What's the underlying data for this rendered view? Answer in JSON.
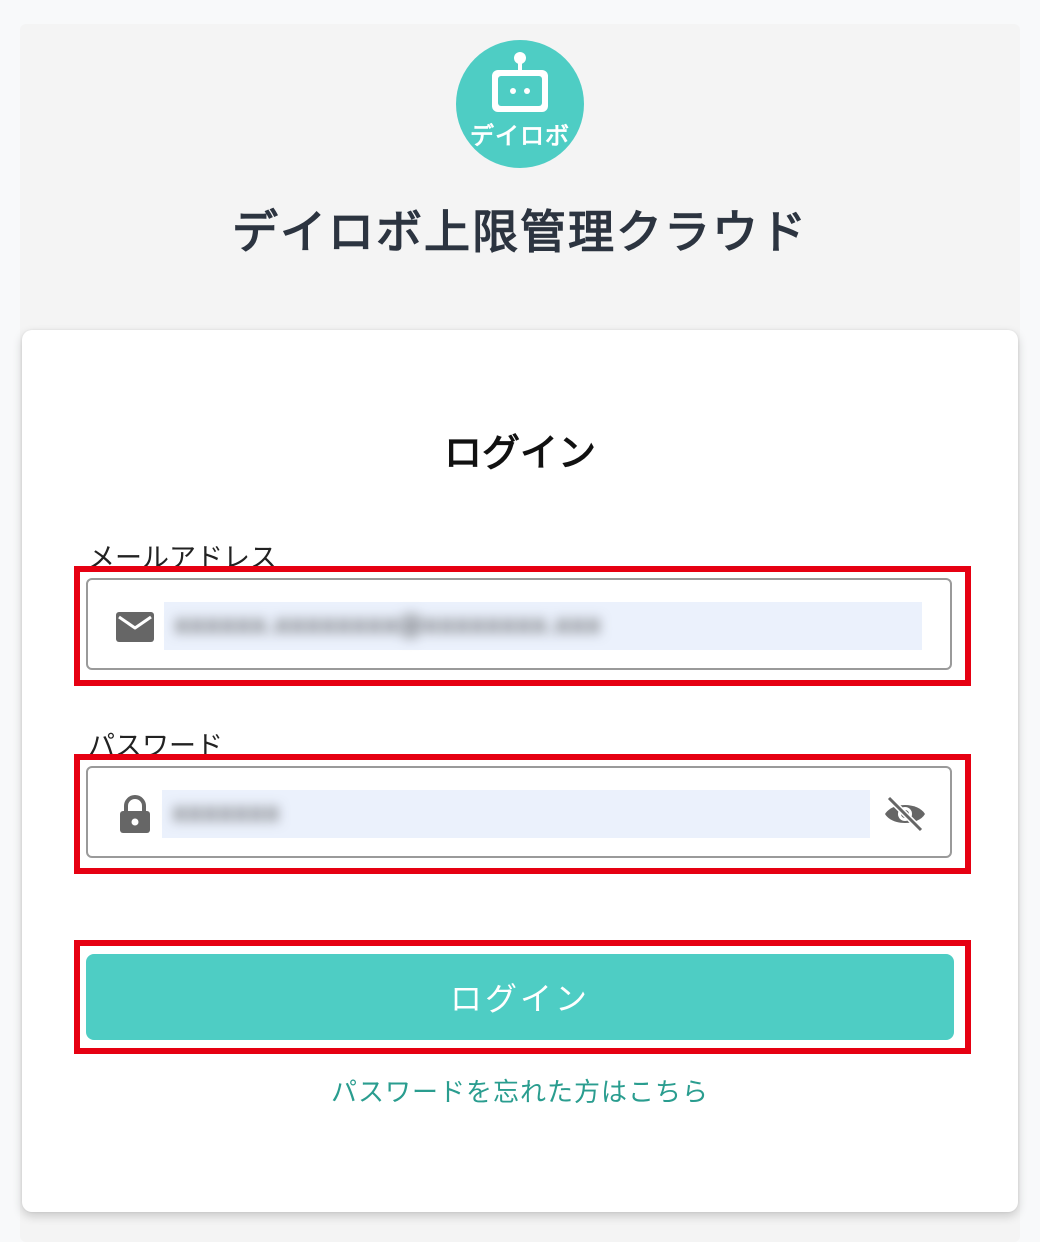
{
  "colors": {
    "brand": "#4ecdc4",
    "highlight": "#e60012",
    "link": "#2a9d8f",
    "title": "#2c3440"
  },
  "header": {
    "logo_text": "デイロボ",
    "app_title": "デイロボ上限管理クラウド"
  },
  "login_form": {
    "title": "ログイン",
    "email": {
      "label": "メールアドレス",
      "icon": "mail-icon",
      "value": "xxxxxx.xxxxxxxx@xxxxxxxx.xxx"
    },
    "password": {
      "label": "パスワード",
      "icon": "lock-icon",
      "value": "xxxxxxx",
      "toggle_icon": "eye-off-icon"
    },
    "submit_label": "ログイン",
    "forgot_password_link": "パスワードを忘れた方はこちら"
  }
}
